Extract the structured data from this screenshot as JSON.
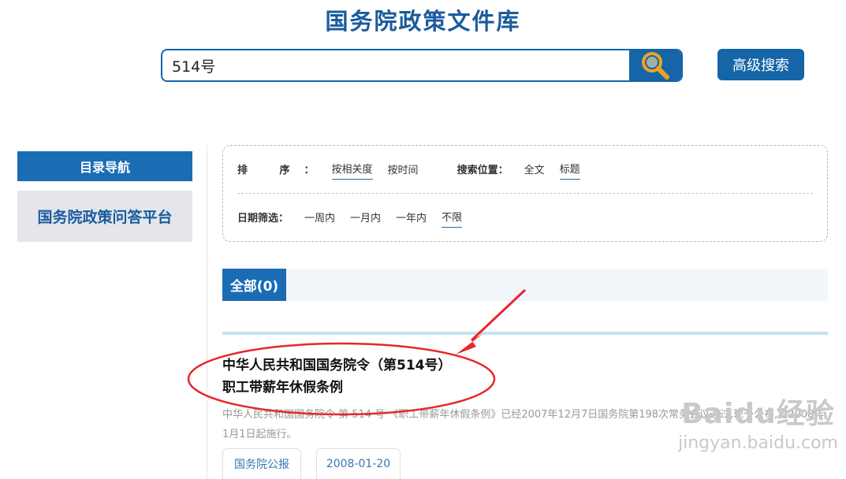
{
  "header": {
    "title": "国务院政策文件库"
  },
  "search": {
    "value": "514号",
    "search_icon": "search-icon",
    "advanced_label": "高级搜索"
  },
  "sidebar": {
    "header": "目录导航",
    "items": [
      {
        "label": "国务院政策问答平台"
      }
    ]
  },
  "filters": {
    "sort_label": "排 序：",
    "sort_options": [
      {
        "label": "按相关度",
        "active": true
      },
      {
        "label": "按时间",
        "active": false
      }
    ],
    "position_label": "搜索位置：",
    "position_options": [
      {
        "label": "全文",
        "active": false
      },
      {
        "label": "标题",
        "active": true
      }
    ],
    "date_label": "日期筛选：",
    "date_options": [
      {
        "label": "一周内",
        "active": false
      },
      {
        "label": "一月内",
        "active": false
      },
      {
        "label": "一年内",
        "active": false
      },
      {
        "label": "不限",
        "active": true
      }
    ]
  },
  "tabs": {
    "all_label": "全部(0)"
  },
  "results": [
    {
      "title_line1": "中华人民共和国国务院令（第514号）",
      "title_line2": "职工带薪年休假条例",
      "description": "中华人民共和国国务院令 第 514 号 《职工带薪年休假条例》已经2007年12月7日国务院第198次常务会议通过,现予公布,自2008年1月1日起施行。",
      "source": "国务院公报",
      "date": "2008-01-20"
    }
  ],
  "watermark": {
    "logo": "Baidu经验",
    "url": "jingyan.baidu.com"
  },
  "colors": {
    "brand_blue": "#1565a8",
    "title_blue": "#1a5b9c",
    "annotation_red": "#e8262b"
  }
}
